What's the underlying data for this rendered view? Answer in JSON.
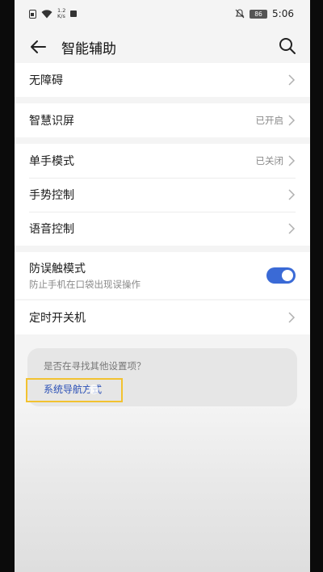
{
  "status_bar": {
    "net_speed_value": "1.2",
    "net_speed_unit": "K/s",
    "battery": "86",
    "time": "5:06"
  },
  "header": {
    "title": "智能辅助"
  },
  "sections": [
    {
      "items": [
        {
          "label": "无障碍",
          "value": ""
        }
      ]
    },
    {
      "items": [
        {
          "label": "智慧识屏",
          "value": "已开启"
        }
      ]
    },
    {
      "items": [
        {
          "label": "单手模式",
          "value": "已关闭"
        },
        {
          "label": "手势控制",
          "value": ""
        },
        {
          "label": "语音控制",
          "value": ""
        }
      ]
    },
    {
      "items": [
        {
          "label": "防误触模式",
          "sublabel": "防止手机在口袋出现误操作",
          "toggle_on": true
        }
      ]
    },
    {
      "items": [
        {
          "label": "定时开关机",
          "value": ""
        }
      ]
    }
  ],
  "suggestion": {
    "question": "是否在寻找其他设置项？",
    "link": "系统导航方式"
  },
  "colors": {
    "accent": "#3a6ad6",
    "link": "#2a4fb6",
    "highlight": "#f2c230"
  }
}
